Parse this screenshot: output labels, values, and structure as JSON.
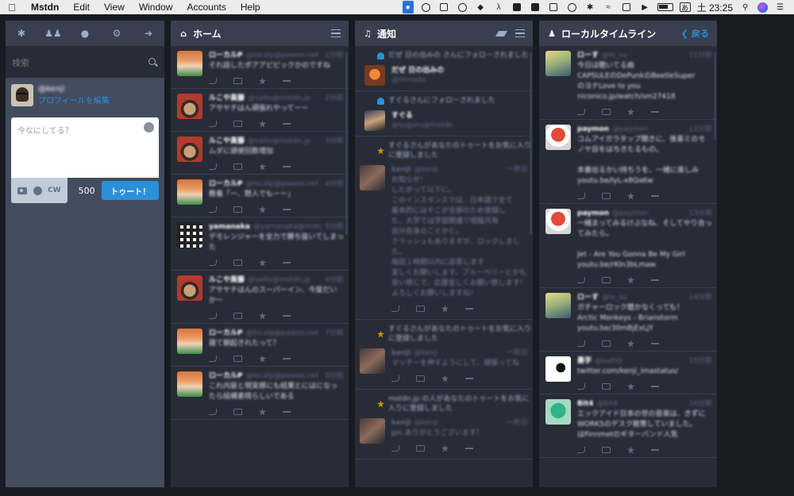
{
  "menubar": {
    "app_name": "Mstdn",
    "items": [
      "Edit",
      "View",
      "Window",
      "Accounts",
      "Help"
    ],
    "clock": "土 23:25",
    "ime": "あ"
  },
  "compose": {
    "search_placeholder": "検索",
    "account_handle": "@kenji",
    "edit_profile": "プロフィールを編集",
    "textarea_placeholder": "今なにしてる？",
    "cw_label": "CW",
    "char_count": "500",
    "toot_label": "トゥート！"
  },
  "home": {
    "title": "ホーム",
    "statuses": [
      {
        "name": "ローカルP",
        "acct": "@localp@pawoo.net",
        "time": "1分前",
        "text": "それ話したポアアピピックかのですね",
        "avatar": "av-anime"
      },
      {
        "name": "ルこや斎藤",
        "acct": "@saito@mstdn.jp",
        "time": "2分前",
        "text": "アサヤチはん頑張れやってーー",
        "avatar": "av-face"
      },
      {
        "name": "ルこや斎藤",
        "acct": "@saito@mstdn.jp",
        "time": "3分前",
        "text": "ムダに頭使回数増加",
        "avatar": "av-face"
      },
      {
        "name": "ローカルP",
        "acct": "@localp@pawoo.net",
        "time": "4分前",
        "text": "教養「ー、黙人でもーー」",
        "avatar": "av-anime"
      },
      {
        "name": "yamanaka",
        "acct": "@yamanaka@mstdn.jp",
        "time": "5分前",
        "text": "デモレンジャーを全力で勝ち抜いてしまった",
        "avatar": "av-grid"
      },
      {
        "name": "ルこや斎藤",
        "acct": "@saito@mstdn.jp",
        "time": "6分前",
        "text": "アサヤチはんのスーパーイン、今度だいかー",
        "avatar": "av-face"
      },
      {
        "name": "ローカルP",
        "acct": "@localp@pawoo.net",
        "time": "7分前",
        "text": "寝て朝起きれたって？",
        "avatar": "av-anime"
      },
      {
        "name": "ローカルP",
        "acct": "@localp@pawoo.net",
        "time": "8分前",
        "text": "これ内容と現実感にも結果とにはになったら結構素晴らしいである",
        "avatar": "av-anime"
      }
    ]
  },
  "notifications": {
    "title": "通知",
    "items": [
      {
        "kind": "follow",
        "line": "だぜ 日の出みの さんにフォローされました",
        "name": "だぜ 日の出みの",
        "acct": "@minoda",
        "avatar": "av-orange"
      },
      {
        "kind": "follow",
        "line": "すぐるさんにフォローされました",
        "name": "すぐる",
        "acct": "@suguru@mstdn",
        "avatar": "av-mask"
      },
      {
        "kind": "fav",
        "line": "すぐるさんがあなたのトゥートをお気に入りに登録しました",
        "name": "kenji",
        "acct": "@kenji",
        "time": "一昨日",
        "text": "お知らせ！\nしたがって以下に。\nこのインスタンスでは、日本語で全て\n基本的にはそこが全部のため登録し\nた、大学では学部関連で情報共有\n自分自身のことかと。\nクラッシュもありますが、ロックしました。\n毎回１時間以内に返答します\n宜しくお願いします。ブルーベリーとかも\n良い感じで、応援宜しくお願い致します！\nよろしくお願いしますね！　",
        "avatar": "av-dark"
      },
      {
        "kind": "fav",
        "line": "すぐるさんがあなたのトゥートをお気に入りに登録しました",
        "name": "kenji",
        "acct": "@kenji",
        "time": "一昨日",
        "text": "マッチーを押すようにして、頑張ってね",
        "avatar": "av-dark"
      },
      {
        "kind": "fav",
        "line": "mstdn.jp の人があなたのトゥートをお気に入りに登録しました",
        "name": "kenji",
        "acct": "@kenji",
        "time": "一昨日",
        "text": "jpn ありがとうございます！",
        "avatar": "av-dark"
      }
    ]
  },
  "local": {
    "title": "ローカルタイムライン",
    "back_label": "戻る",
    "statuses": [
      {
        "name": "ローす",
        "acct": "@lo_su",
        "time": "11分前",
        "text": "今日は聴いてる曲\nCAPSULEのDePunkのBeetleSuper\nのヨナLove to you\nniconico.jp/watch/sm27418",
        "avatar": "av-blond"
      },
      {
        "name": "paymon",
        "acct": "@paymon",
        "time": "12分前",
        "text": "コムアイガラタップ聞きに、後輩ミのモノヤ目をはちきたるもの。\n\n本番出るかい持ちうを、一緒に楽しみ\nyoutu.be/lyL-x8Qa6w",
        "avatar": "av-red"
      },
      {
        "name": "paymon",
        "acct": "@paymon",
        "time": "13分前",
        "text": "一緒まってみるけぶなね、そしてやり合ってみたら。\n\nJet - Are You Gonna Be My Girl\nyoutu.be/rKIn3bLmaw",
        "avatar": "av-red"
      },
      {
        "name": "ローす",
        "acct": "@lo_su",
        "time": "14分前",
        "text": "ガチャーロック聴かなくっても！\nArctic Monkeys - Brianstorm\nyoutu.be/30mBjExLjY",
        "avatar": "av-blond"
      },
      {
        "name": "墨字",
        "acct": "@sumiji",
        "time": "15分前",
        "text": "twitter.com/kenji_imastatus/",
        "avatar": "av-ink"
      },
      {
        "name": "Bit4",
        "acct": "@bit4",
        "time": "16分前",
        "text": "エックアイド日本の世の音楽は、きずにWORKSのデスク散策していました。\nはFinnmetのギターバンド人気",
        "avatar": "av-green"
      }
    ]
  }
}
